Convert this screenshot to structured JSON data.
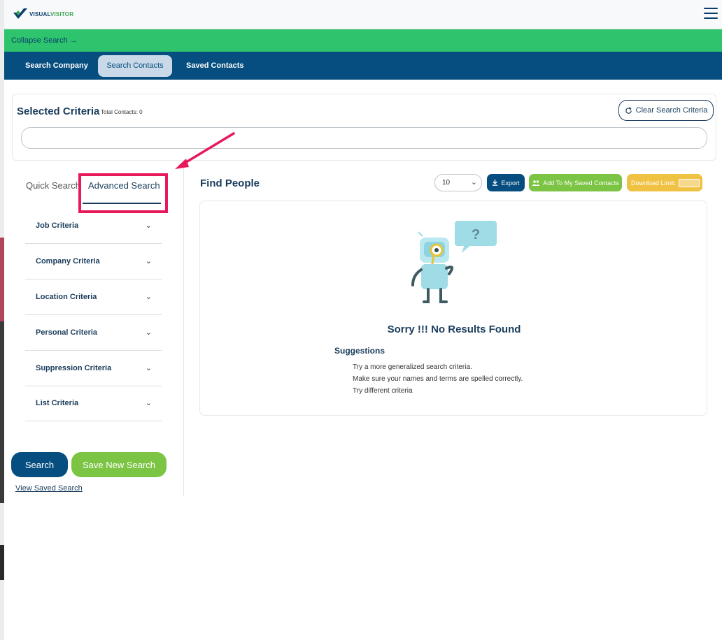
{
  "header": {
    "logo_text_primary": "VISUAL",
    "logo_text_accent": "VISITOR",
    "menu_icon": "hamburger-icon"
  },
  "collapse_bar": {
    "label": "Collapse Search →"
  },
  "nav": {
    "tabs": [
      {
        "label": "Search Company"
      },
      {
        "label": "Search Contacts",
        "active": true
      },
      {
        "label": "Saved Contacts"
      }
    ]
  },
  "criteria": {
    "title": "Selected Criteria",
    "total": "Total Contacts: 0",
    "clear_label": "Clear Search Criteria",
    "input_value": ""
  },
  "search_tabs": {
    "quick": "Quick Search",
    "advanced": "Advanced Search"
  },
  "accordion": [
    {
      "label": "Job Criteria"
    },
    {
      "label": "Company Criteria"
    },
    {
      "label": "Location Criteria"
    },
    {
      "label": "Personal Criteria"
    },
    {
      "label": "Suppression Criteria"
    },
    {
      "label": "List Criteria"
    }
  ],
  "actions": {
    "search": "Search",
    "save_new": "Save New Search",
    "view_saved": "View Saved Search"
  },
  "results": {
    "title": "Find People",
    "per_page": "10",
    "export": "Export",
    "add_saved": "Add To My Saved Contacts",
    "download_limit": "Download Limit:",
    "no_results": "Sorry !!! No Results Found",
    "suggestions_title": "Suggestions",
    "suggestions": [
      "Try a more generalized search criteria.",
      "Make sure your names and terms are spelled correctly.",
      "Try different criteria"
    ]
  },
  "colors": {
    "navy": "#064e7f",
    "green_bar": "#2ec46e",
    "green_button": "#7cc443",
    "yellow_button": "#f0c244",
    "annotation": "#e8195a"
  }
}
